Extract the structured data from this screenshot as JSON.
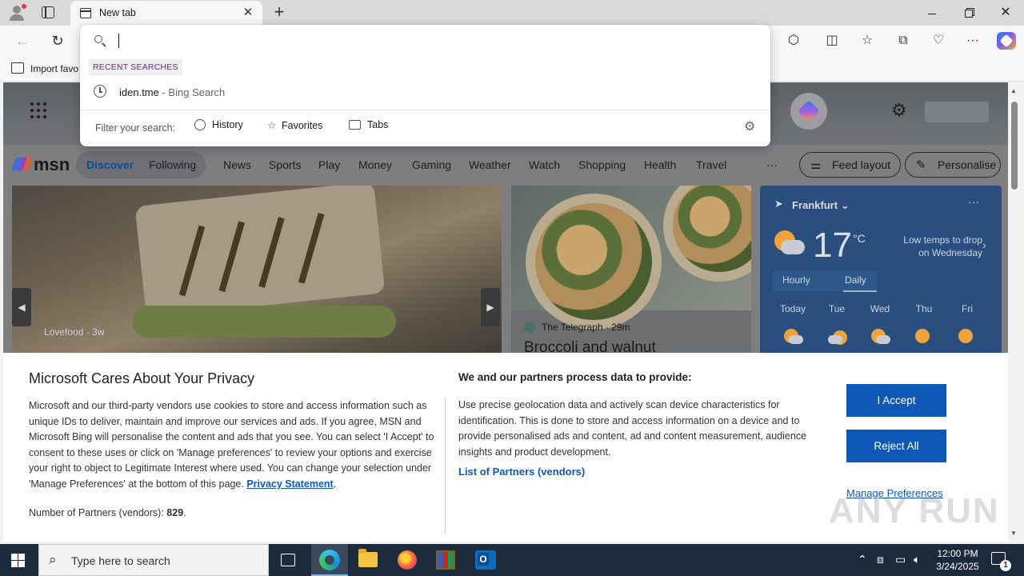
{
  "browser": {
    "tab_title": "New tab",
    "tab_close": "✕",
    "new_tab": "+",
    "window_controls": {
      "close": "✕"
    }
  },
  "favorites_bar": {
    "import_label": "Import favo"
  },
  "address_dropdown": {
    "input_value": "",
    "recent_label": "RECENT SEARCHES",
    "suggestion": {
      "query": "iden.tme",
      "source": " - Bing Search"
    },
    "filter_label": "Filter your search:",
    "filters": [
      "History",
      "Favorites",
      "Tabs"
    ]
  },
  "msn": {
    "logo_text": "msn",
    "nav": [
      "Discover",
      "Following",
      "News",
      "Sports",
      "Play",
      "Money",
      "Gaming",
      "Weather",
      "Watch",
      "Shopping",
      "Health",
      "Travel"
    ],
    "more": "···",
    "feed_layout": "Feed layout",
    "personalise": "Personalise",
    "card1": {
      "source": "Lovefood · 3w",
      "prev": "◀",
      "next": "▶"
    },
    "card2": {
      "source": "The Telegraph · 29m",
      "headline": "Broccoli and walnut"
    },
    "weather": {
      "location": "Frankfurt",
      "chevron": "⌄",
      "dots": "···",
      "temp": "17",
      "unit": "°C",
      "note": "Low temps to drop on Wednesday",
      "tabs": [
        "Hourly",
        "Daily"
      ],
      "selected_tab": "Daily",
      "days": [
        "Today",
        "Tue",
        "Wed",
        "Thu",
        "Fri"
      ]
    }
  },
  "privacy": {
    "title": "Microsoft Cares About Your Privacy",
    "lead": "Microsoft and our third-party vendors use cookies to store and access information such as unique IDs to deliver, maintain and improve our services and ads. If you agree, MSN and Microsoft Bing will personalise the content and ads that you see. You can select 'I Accept' to consent to these uses or click on 'Manage preferences' to review your options and exercise your right to object to Legitimate Interest where used.  You can change your selection under 'Manage Preferences' at the bottom of this page.",
    "privacy_link": "Privacy Statement",
    "partners_label": "Number of Partners (vendors): ",
    "partners_count": "829",
    "purposes_title": "We and our partners process data to provide:",
    "purposes_desc": "Use precise geolocation data and actively scan device characteristics for identification. This is done to store and access information on a device and to provide personalised ads and content, ad and content measurement, audience insights and product development.",
    "vendors_link": "List of Partners (vendors)",
    "accept": "I Accept",
    "reject": "Reject All",
    "manage": "Manage Preferences"
  },
  "taskbar": {
    "search_placeholder": "Type here to search",
    "time": "12:00 PM",
    "date": "3/24/2025",
    "notification_count": "1"
  },
  "watermark": "ANY RUN",
  "colors": {
    "accent": "#0e58b8",
    "taskbar": "#1c2b3c",
    "weather_bg": "#2a4f7e"
  }
}
